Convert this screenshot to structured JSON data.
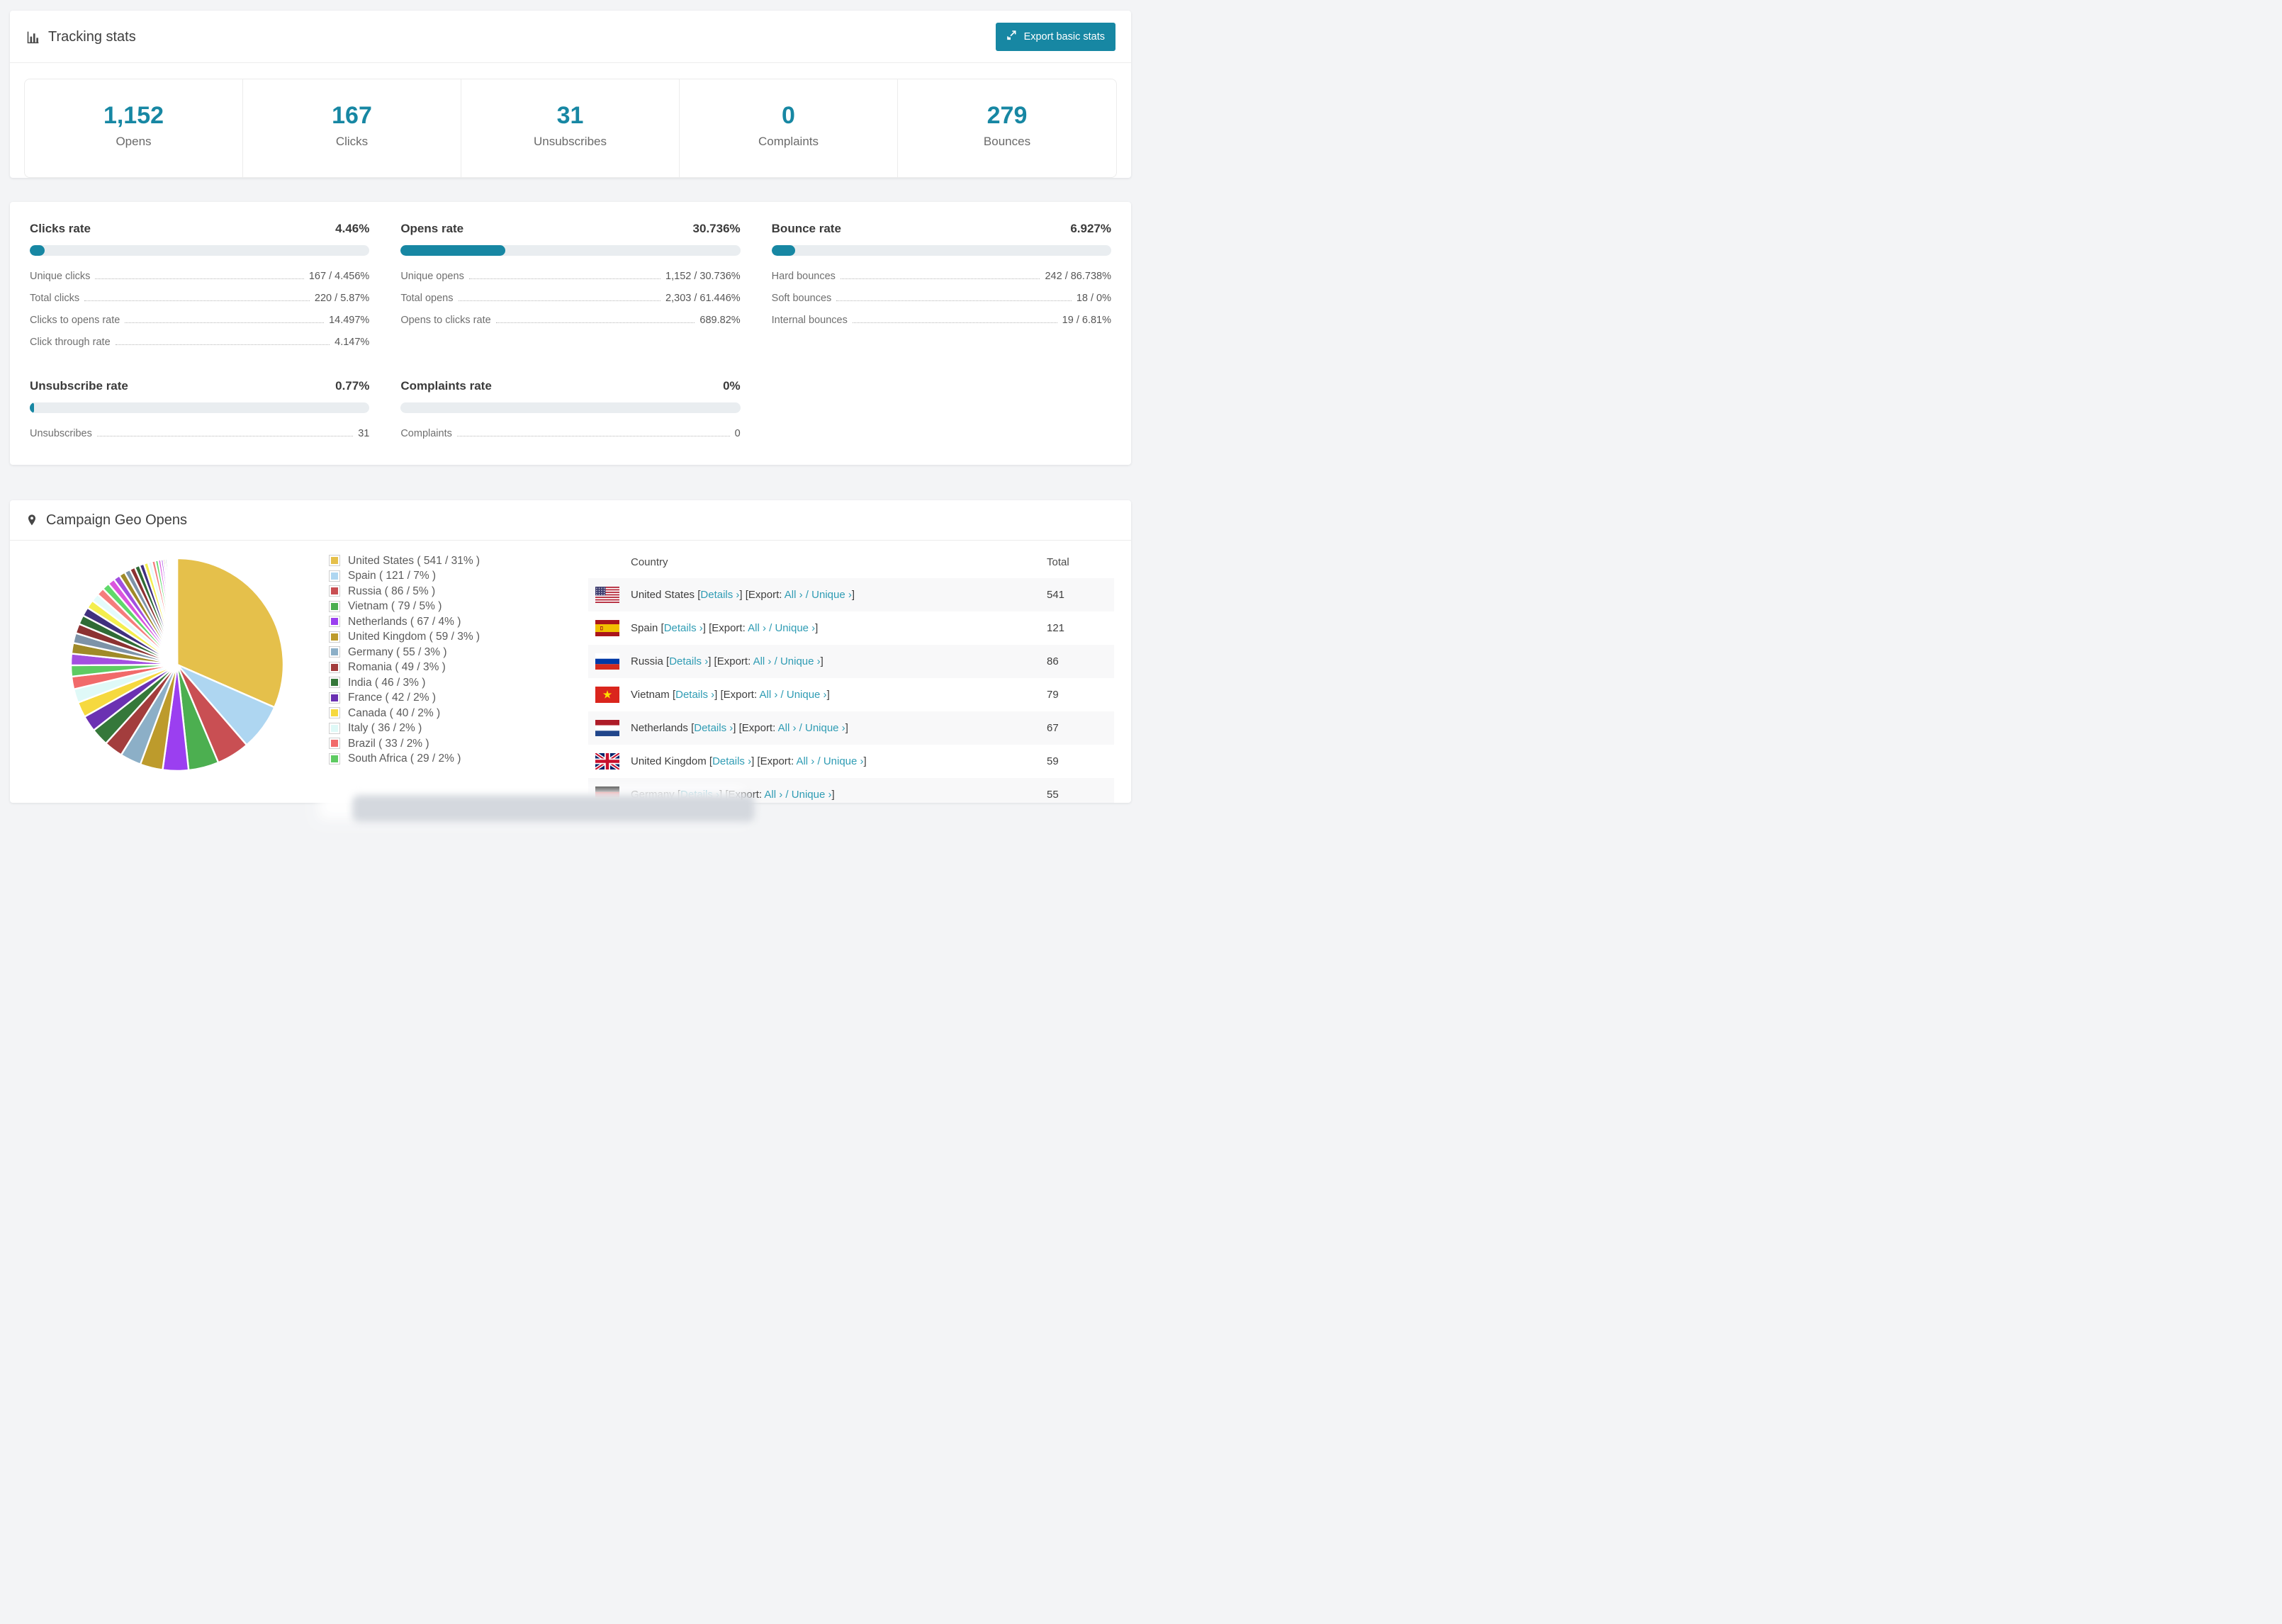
{
  "colors": {
    "accent": "#1787a3",
    "link": "#2f9cb4",
    "track": "#e9edf0",
    "page_bg": "#f3f4f6"
  },
  "header": {
    "title": "Tracking stats",
    "export_button": "Export basic stats"
  },
  "summary_stats": [
    {
      "value": "1,152",
      "label": "Opens"
    },
    {
      "value": "167",
      "label": "Clicks"
    },
    {
      "value": "31",
      "label": "Unsubscribes"
    },
    {
      "value": "0",
      "label": "Complaints"
    },
    {
      "value": "279",
      "label": "Bounces"
    }
  ],
  "rate_cards": [
    {
      "title": "Clicks rate",
      "value": "4.46%",
      "pct": 4.46,
      "rows": [
        {
          "label": "Unique clicks",
          "value": "167 / 4.456%"
        },
        {
          "label": "Total clicks",
          "value": "220 / 5.87%"
        },
        {
          "label": "Clicks to opens rate",
          "value": "14.497%"
        },
        {
          "label": "Click through rate",
          "value": "4.147%"
        }
      ]
    },
    {
      "title": "Opens rate",
      "value": "30.736%",
      "pct": 30.736,
      "rows": [
        {
          "label": "Unique opens",
          "value": "1,152 / 30.736%"
        },
        {
          "label": "Total opens",
          "value": "2,303 / 61.446%"
        },
        {
          "label": "Opens to clicks rate",
          "value": "689.82%"
        }
      ]
    },
    {
      "title": "Bounce rate",
      "value": "6.927%",
      "pct": 6.927,
      "rows": [
        {
          "label": "Hard bounces",
          "value": "242 / 86.738%"
        },
        {
          "label": "Soft bounces",
          "value": "18 / 0%"
        },
        {
          "label": "Internal bounces",
          "value": "19 / 6.81%"
        }
      ]
    },
    {
      "title": "Unsubscribe rate",
      "value": "0.77%",
      "pct": 0.77,
      "rows": [
        {
          "label": "Unsubscribes",
          "value": "31"
        }
      ]
    },
    {
      "title": "Complaints rate",
      "value": "0%",
      "pct": 0,
      "rows": [
        {
          "label": "Complaints",
          "value": "0"
        }
      ]
    }
  ],
  "geo": {
    "title": "Campaign Geo Opens",
    "table": {
      "headers": [
        "Country",
        "Total"
      ],
      "link_labels": {
        "details": "Details ›",
        "export_prefix": "Export:",
        "all": "All ›",
        "unique": "Unique ›"
      },
      "rows": [
        {
          "country": "United States",
          "flag": "us",
          "total": "541"
        },
        {
          "country": "Spain",
          "flag": "es",
          "total": "121"
        },
        {
          "country": "Russia",
          "flag": "ru",
          "total": "86"
        },
        {
          "country": "Vietnam",
          "flag": "vn",
          "total": "79"
        },
        {
          "country": "Netherlands",
          "flag": "nl",
          "total": "67"
        },
        {
          "country": "United Kingdom",
          "flag": "gb",
          "total": "59"
        },
        {
          "country": "Germany",
          "flag": "de",
          "total": "55",
          "partially_visible": true
        }
      ]
    }
  },
  "chart_data": {
    "type": "pie",
    "title": "Campaign Geo Opens",
    "legend_position": "right",
    "start_angle": "top",
    "direction": "clockwise",
    "series": [
      {
        "name": "United States",
        "value": 541,
        "pct": 31,
        "color": "#e5c04b"
      },
      {
        "name": "Spain",
        "value": 121,
        "pct": 7,
        "color": "#aed6f1"
      },
      {
        "name": "Russia",
        "value": 86,
        "pct": 5,
        "color": "#c94f53"
      },
      {
        "name": "Vietnam",
        "value": 79,
        "pct": 5,
        "color": "#4caf50"
      },
      {
        "name": "Netherlands",
        "value": 67,
        "pct": 4,
        "color": "#9b3ff0"
      },
      {
        "name": "United Kingdom",
        "value": 59,
        "pct": 3,
        "color": "#bd9b2c"
      },
      {
        "name": "Germany",
        "value": 55,
        "pct": 3,
        "color": "#8cafc7"
      },
      {
        "name": "Romania",
        "value": 49,
        "pct": 3,
        "color": "#a33d3d"
      },
      {
        "name": "India",
        "value": 46,
        "pct": 3,
        "color": "#35783a"
      },
      {
        "name": "France",
        "value": 42,
        "pct": 2,
        "color": "#6b31b2"
      },
      {
        "name": "Canada",
        "value": 40,
        "pct": 2,
        "color": "#f6d93f"
      },
      {
        "name": "Italy",
        "value": 36,
        "pct": 2,
        "color": "#dff9f7"
      },
      {
        "name": "Brazil",
        "value": 33,
        "pct": 2,
        "color": "#f16a6a"
      },
      {
        "name": "South Africa",
        "value": 29,
        "pct": 2,
        "color": "#5ecb62"
      }
    ],
    "others": {
      "note": "long tail of unlabeled thin slices, values estimated from pixels",
      "values": [
        30,
        28,
        26,
        25,
        24,
        23,
        22,
        21,
        20,
        19,
        18,
        17,
        16,
        15,
        14,
        13,
        12,
        11,
        10,
        9,
        8,
        7,
        6,
        5,
        5,
        4,
        4,
        3,
        3,
        2,
        2,
        2,
        1,
        1,
        1,
        1,
        1,
        1
      ],
      "palette": [
        "#a34fe0",
        "#a08a28",
        "#7d93a8",
        "#8c3232",
        "#2f6b35",
        "#40307e",
        "#f4ee4e",
        "#e4fbfb",
        "#f57d7d",
        "#5fd96b",
        "#da55dd"
      ]
    }
  }
}
